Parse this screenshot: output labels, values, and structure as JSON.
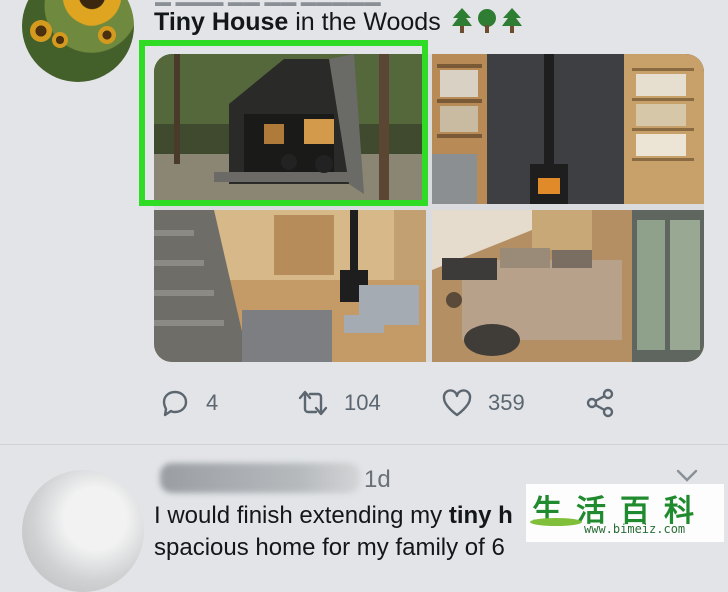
{
  "tweet1": {
    "title_bold": "Tiny House",
    "title_rest": " in the Woods",
    "title_emoji": [
      "evergreen-tree",
      "deciduous-tree",
      "evergreen-tree"
    ],
    "photos": [
      {
        "name": "cabin-exterior"
      },
      {
        "name": "wood-stove-bookshelves"
      },
      {
        "name": "living-room-stairs"
      },
      {
        "name": "bedroom"
      }
    ],
    "actions": {
      "reply_count": "4",
      "retweet_count": "104",
      "like_count": "359"
    }
  },
  "tweet2": {
    "time": "1d",
    "text_before": "I would finish extending my ",
    "text_bold": "tiny h",
    "text_line2": "spacious home for my family of 6"
  },
  "watermark": {
    "chars": "生活百科",
    "url": "www.bimeiz.com"
  },
  "colors": {
    "highlight": "#2fdb25",
    "action_icon": "#5c6670",
    "background": "#e2e4e7"
  }
}
